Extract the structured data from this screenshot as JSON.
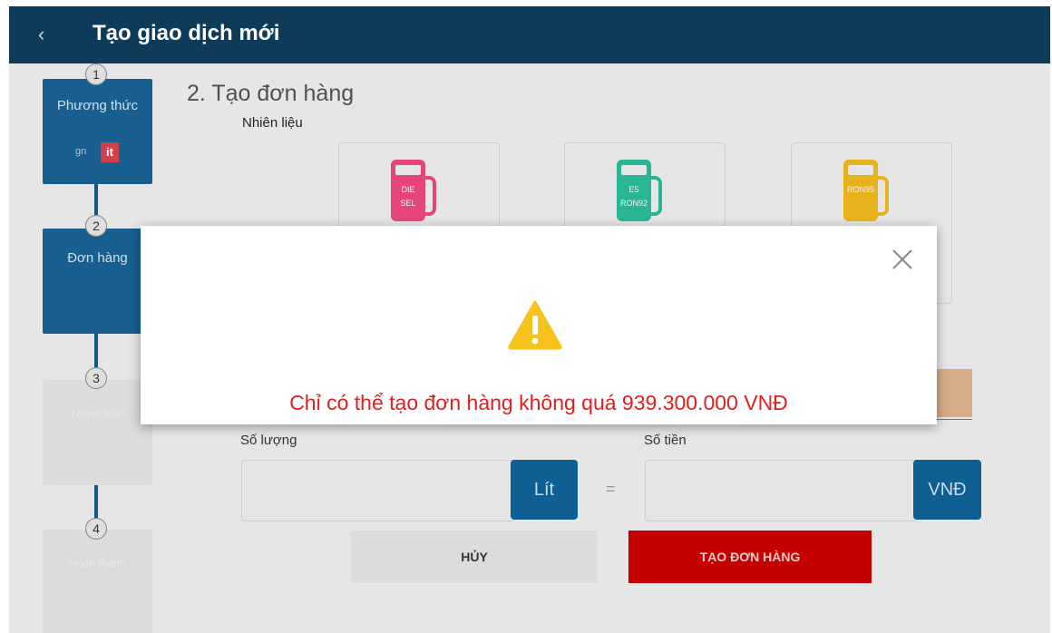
{
  "header": {
    "back_icon": "chevron-left-icon",
    "back_glyph": "‹",
    "title": "Tạo giao dịch mới"
  },
  "steps": [
    {
      "number": "1",
      "label": "Phương thức",
      "state": "completed"
    },
    {
      "number": "2",
      "label": "Đơn hàng",
      "state": "active"
    },
    {
      "number": "3",
      "label": "Thanh toán",
      "state": "inactive"
    },
    {
      "number": "4",
      "label": "Hoàn thành",
      "state": "inactive"
    }
  ],
  "gift": {
    "prefix": "gn",
    "badge": "it"
  },
  "main": {
    "section_title": "2. Tạo đơn hàng",
    "fuel_label": "Nhiên liệu",
    "fuels": [
      {
        "line1": "DIE",
        "line2": "SEL",
        "color": "#e5457a"
      },
      {
        "line1": "E5",
        "line2": "RON92",
        "color": "#29b596"
      },
      {
        "line1": "RON95",
        "line2": "",
        "color": "#e8b21c"
      }
    ],
    "quantity_label": "Số lượng",
    "quantity_unit": "Lít",
    "amount_label": "Số tiền",
    "amount_unit": "VNĐ",
    "equals_sign": "=",
    "cancel_label": "HỦY",
    "create_label": "TẠO ĐƠN HÀNG"
  },
  "dialog": {
    "message": "Chỉ có thể tạo đơn hàng không quá 939.300.000  VNĐ",
    "warning_icon": "warning-triangle-icon",
    "close_icon": "close-icon"
  },
  "colors": {
    "header": "#0e3b5a",
    "accent": "#0f5f92",
    "danger": "#c40000",
    "warning": "#f6c31c",
    "message": "#e41e1e"
  }
}
